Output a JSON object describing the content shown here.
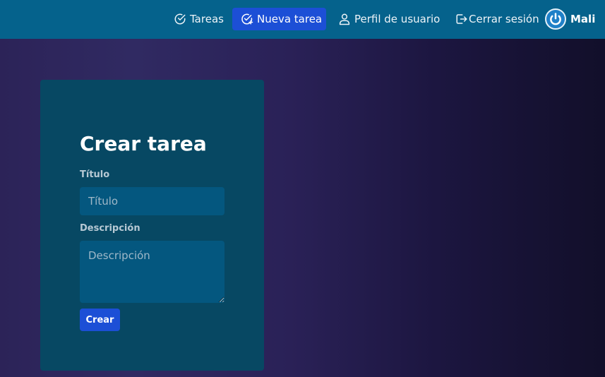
{
  "navbar": {
    "items": [
      {
        "label": "Tareas",
        "icon": "check-circle-icon"
      },
      {
        "label": "Nueva tarea",
        "icon": "check-circle-plus-icon",
        "active": true
      },
      {
        "label": "Perfil de usuario",
        "icon": "user-icon"
      },
      {
        "label": "Cerrar sesión",
        "icon": "logout-icon"
      }
    ],
    "user": {
      "name": "Mali",
      "avatar_icon": "power-icon"
    }
  },
  "form": {
    "title": "Crear tarea",
    "title_field": {
      "label": "Título",
      "placeholder": "Título",
      "value": ""
    },
    "description_field": {
      "label": "Descripción",
      "placeholder": "Descripción",
      "value": ""
    },
    "submit_label": "Crear"
  },
  "colors": {
    "navbar_bg": "#05628c",
    "accent": "#1c4fd6",
    "card_bg": "#074863",
    "input_bg": "#04577f"
  }
}
